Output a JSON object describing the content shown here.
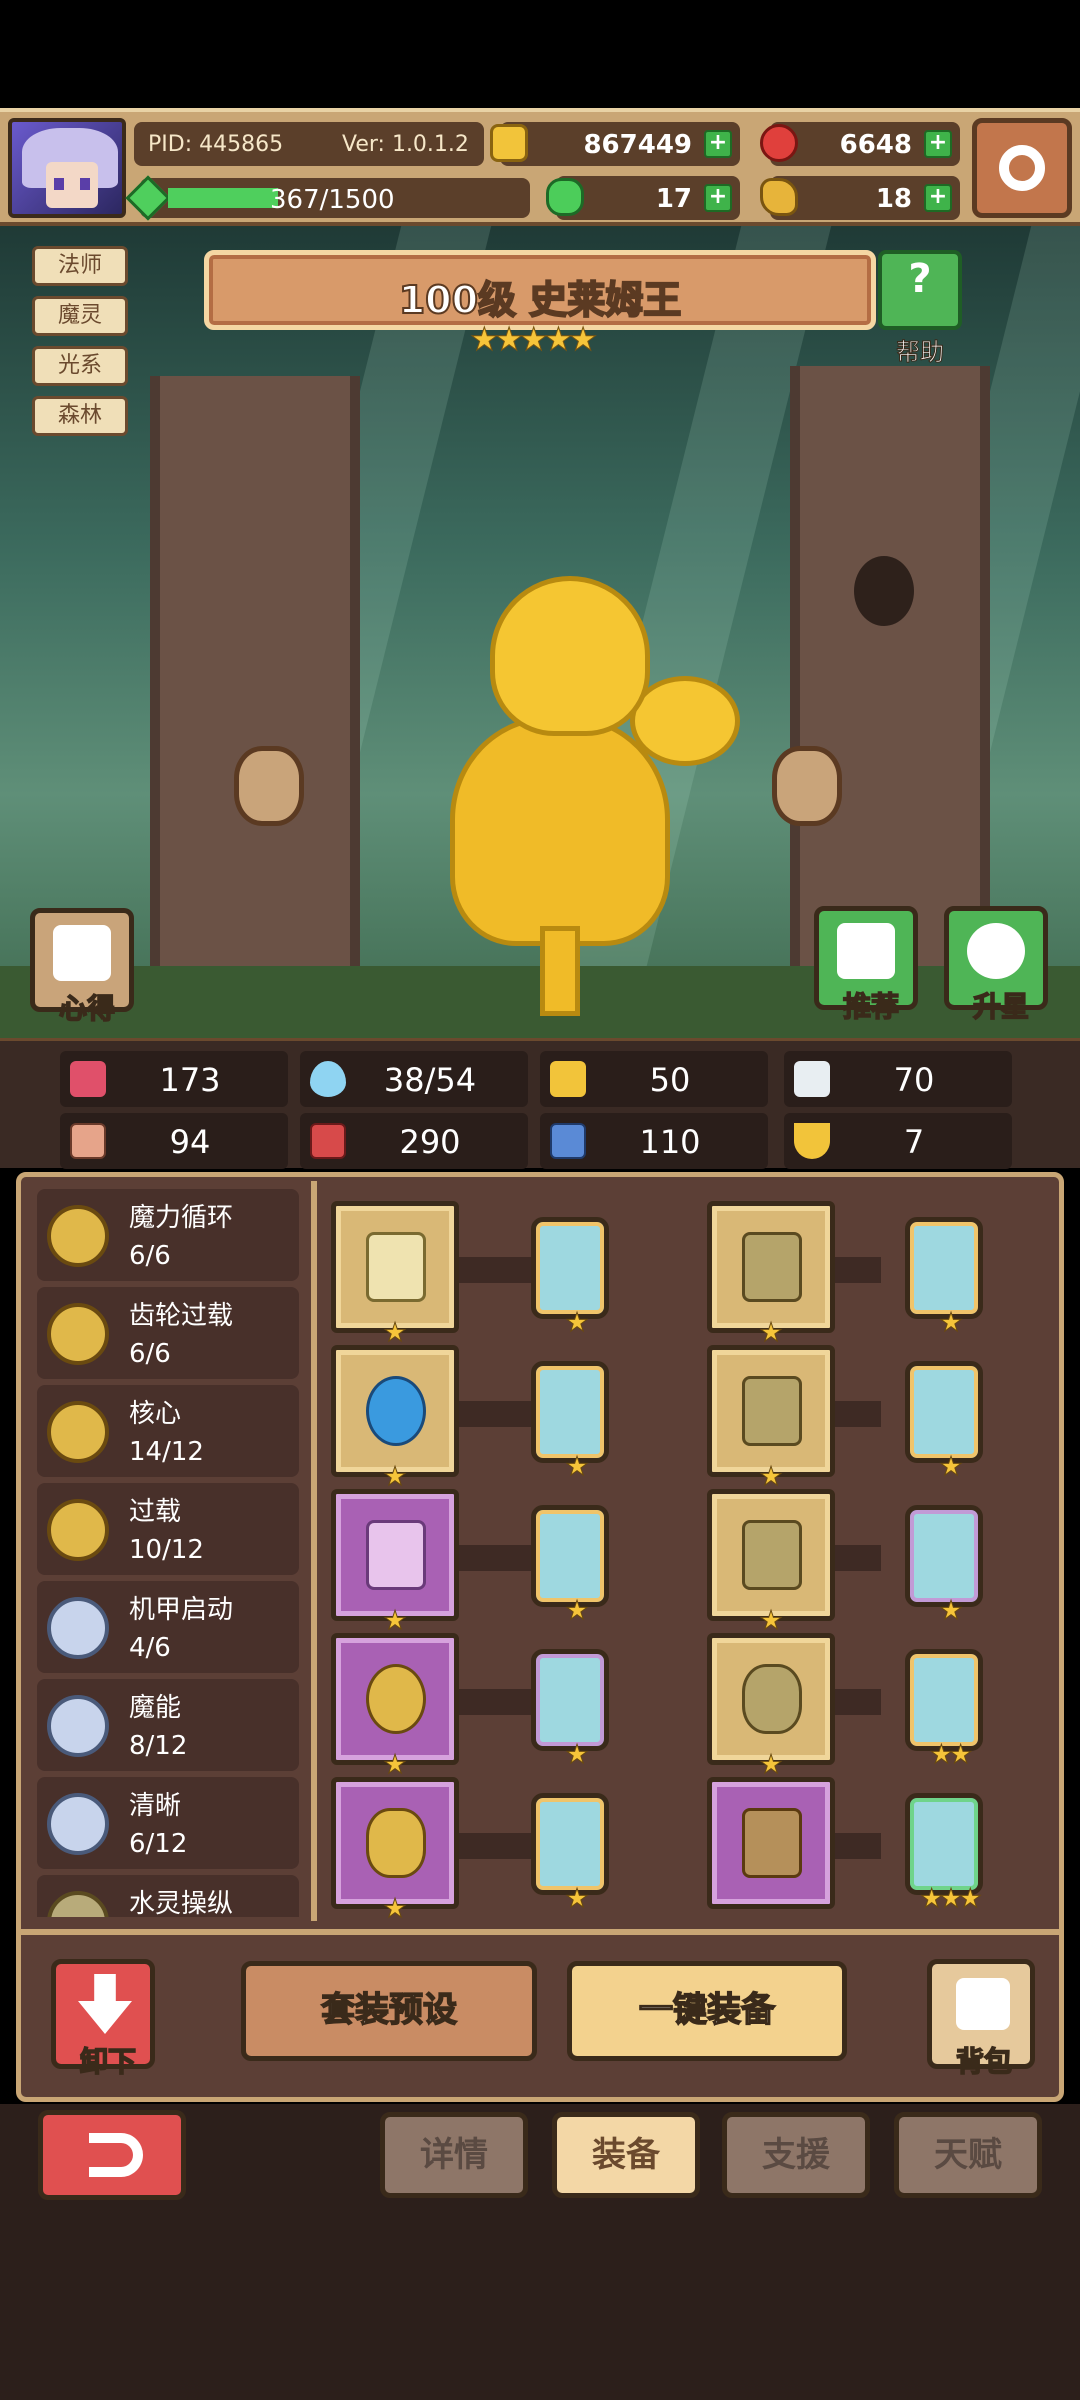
{
  "topbar": {
    "pid": "PID: 445865",
    "version": "Ver: 1.0.1.2",
    "gold": "867449",
    "gems": "6648",
    "energy": "367/1500",
    "clover": "17",
    "bag_item": "18"
  },
  "hero": {
    "tags": [
      "法师",
      "魔灵",
      "光系",
      "森林"
    ],
    "title": "100级 史莱姆王",
    "stars": "★★★★★",
    "help_label": "帮助",
    "insight_label": "心得",
    "recommend_label": "推荐",
    "upgrade_label": "升星"
  },
  "stats": {
    "hp": "173",
    "mana": "38/54",
    "defense": "50",
    "speed": "70",
    "attack": "94",
    "magic": "290",
    "armor": "110",
    "luck": "7"
  },
  "skills": [
    {
      "name": "魔力循环",
      "count": "6/6"
    },
    {
      "name": "齿轮过载",
      "count": "6/6"
    },
    {
      "name": "核心",
      "count": "14/12"
    },
    {
      "name": "过载",
      "count": "10/12"
    },
    {
      "name": "机甲启动",
      "count": "4/6"
    },
    {
      "name": "魔能",
      "count": "8/12"
    },
    {
      "name": "清晰",
      "count": "6/12"
    },
    {
      "name": "水灵操纵",
      "count": ""
    }
  ],
  "equipment": {
    "left": [
      {
        "name": "staff-icon",
        "rarity": "gold",
        "stars": "★",
        "rune_stars": "★"
      },
      {
        "name": "orb-icon",
        "rarity": "gold",
        "stars": "★",
        "rune_stars": "★"
      },
      {
        "name": "necklace-icon",
        "rarity": "purple",
        "stars": "★",
        "rune_stars": "★"
      },
      {
        "name": "amulet-icon",
        "rarity": "purple",
        "stars": "★",
        "rune_stars": "★"
      },
      {
        "name": "ring-icon",
        "rarity": "purple",
        "stars": "★",
        "rune_stars": "★"
      }
    ],
    "right": [
      {
        "name": "helmet-icon",
        "rarity": "gold",
        "stars": "★",
        "rune_stars": "★"
      },
      {
        "name": "armor-icon",
        "rarity": "gold",
        "stars": "★",
        "rune_stars": "★"
      },
      {
        "name": "gauntlet-icon",
        "rarity": "gold",
        "stars": "★",
        "rune_stars": "★"
      },
      {
        "name": "belt-icon",
        "rarity": "gold",
        "stars": "★",
        "rune_stars": "★★"
      },
      {
        "name": "boots-icon",
        "rarity": "purple",
        "stars": "",
        "rune_stars": "★★★"
      }
    ]
  },
  "actions": {
    "unequip": "卸下",
    "preset": "套装预设",
    "quick_equip": "一键装备",
    "bag": "背包"
  },
  "nav": {
    "tabs": [
      "详情",
      "装备",
      "支援",
      "天赋"
    ],
    "active": "装备"
  }
}
